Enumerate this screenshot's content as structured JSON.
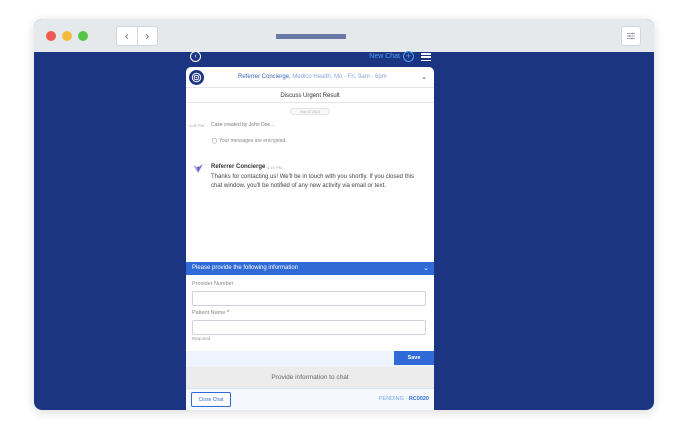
{
  "titlebar": {
    "back_glyph": "‹",
    "forward_glyph": "›"
  },
  "topbar": {
    "new_chat_label": "New Chat"
  },
  "header": {
    "agent": "Referrer Concierge,",
    "org_hours": " Medico Health, Mo - Fri, 9am - 6pm"
  },
  "subject": "Discuss Urgent Result",
  "chat": {
    "date_pill": "Nov 02 2024",
    "system_time": "4:09 PM",
    "system_message": "Case created by John Doe...",
    "encrypted_notice": "Your messages are encrypted.",
    "agent_name": "Referrer Concierge",
    "agent_time": "4:10 PM",
    "agent_message": "Thanks for contacting us! We'll be in touch with you shortly. If you closed this chat window, you'll be notified of any new activity via email or text."
  },
  "form": {
    "title": "Please provide the following information",
    "fields": [
      {
        "label": "Provider Number",
        "value": "",
        "required": false
      },
      {
        "label": "Patient Name",
        "value": "",
        "required": true
      }
    ],
    "required_hint": "Required",
    "save_label": "Save"
  },
  "provide_info_label": "Provide information to chat",
  "footer": {
    "close_label": "Close Chat",
    "status": "PENDING ·",
    "code": "RC0020"
  },
  "colors": {
    "background": "#1c3583",
    "accent": "#2f6ad7",
    "link": "#4a9ff0"
  }
}
